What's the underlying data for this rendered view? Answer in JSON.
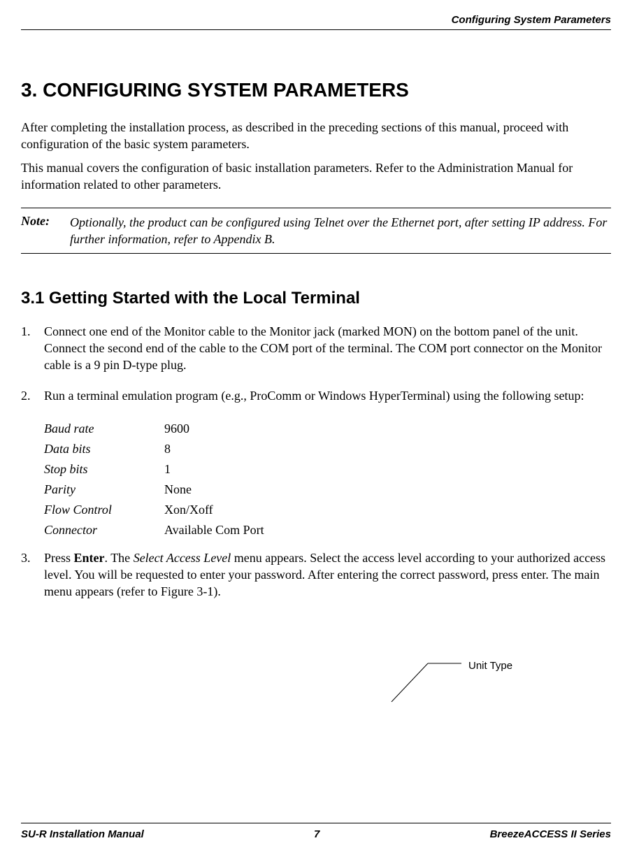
{
  "header": {
    "right_text": "Configuring System Parameters"
  },
  "chapter": {
    "title": "3. CONFIGURING SYSTEM PARAMETERS"
  },
  "intro": {
    "p1": "After completing the installation process, as described in the preceding sections of this manual, proceed with configuration of the basic system parameters.",
    "p2": "This manual covers the configuration of basic installation parameters. Refer to the Administration Manual for information related to other parameters."
  },
  "note": {
    "label": "Note:",
    "text": "Optionally, the product can be configured using Telnet over the Ethernet port, after setting IP address. For further information, refer to Appendix B."
  },
  "section": {
    "title": "3.1  Getting Started with the Local Terminal"
  },
  "steps": {
    "s1": "Connect one end of the Monitor cable to the Monitor jack (marked MON) on the bottom panel of the unit. Connect the second end of the cable to the COM port of the terminal. The COM port connector on the Monitor cable is a 9 pin D-type plug.",
    "s2": "Run a terminal emulation program (e.g., ProComm or Windows HyperTerminal) using the following setup:",
    "s3_a": "Press ",
    "s3_b": "Enter",
    "s3_c": ". The ",
    "s3_d": "Select Access Level",
    "s3_e": " menu appears. Select the access level according to your authorized access level. You will be requested to enter your password. After entering the correct password, press enter. The main menu appears (refer to Figure 3-1)."
  },
  "setup": {
    "rows": [
      {
        "param": "Baud rate",
        "value": "9600"
      },
      {
        "param": "Data bits",
        "value": "8"
      },
      {
        "param": "Stop bits",
        "value": "1"
      },
      {
        "param": "Parity",
        "value": "None"
      },
      {
        "param": "Flow Control",
        "value": "Xon/Xoff"
      },
      {
        "param": "Connector",
        "value": "Available Com Port"
      }
    ]
  },
  "callout": {
    "label": "Unit Type"
  },
  "footer": {
    "left": "SU-R Installation Manual",
    "center": "7",
    "right": "BreezeACCESS II Series"
  }
}
